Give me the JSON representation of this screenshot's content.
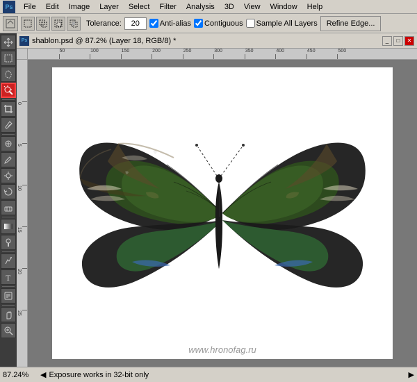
{
  "menubar": {
    "logo": "Ps",
    "items": [
      "File",
      "Edit",
      "Image",
      "Layer",
      "Select",
      "Filter",
      "Analysis",
      "3D",
      "View",
      "Window",
      "Help"
    ]
  },
  "optionsbar": {
    "tolerance_label": "Tolerance:",
    "tolerance_value": "20",
    "anti_alias_label": "Anti-alias",
    "contiguous_label": "Contiguous",
    "sample_all_layers_label": "Sample All Layers",
    "refine_edge_label": "Refine Edge...",
    "anti_alias_checked": true,
    "contiguous_checked": true,
    "sample_all_layers_checked": false
  },
  "document": {
    "title": "shablon.psd @ 87.2% (Layer 18, RGB/8) *"
  },
  "statusbar": {
    "zoom": "87.24%",
    "info": "Exposure works in 32-bit only"
  },
  "watermark": "www.hronofag.ru",
  "ruler": {
    "h_labels": [
      "50",
      "100",
      "150",
      "200",
      "250",
      "300",
      "350",
      "400",
      "450",
      "500"
    ],
    "v_labels": [
      "0",
      "5",
      "10",
      "15",
      "20",
      "25"
    ]
  },
  "toolbar": {
    "tools": [
      {
        "id": "move",
        "icon": "✦",
        "active": false
      },
      {
        "id": "rect-marquee",
        "icon": "⬚",
        "active": false
      },
      {
        "id": "lasso",
        "icon": "𝓛",
        "active": false
      },
      {
        "id": "magic-wand",
        "icon": "✲",
        "active": true,
        "highlighted": true
      },
      {
        "id": "crop",
        "icon": "⊹",
        "active": false
      },
      {
        "id": "eyedropper",
        "icon": "⊿",
        "active": false
      },
      {
        "id": "healing",
        "icon": "✚",
        "active": false
      },
      {
        "id": "brush",
        "icon": "✏",
        "active": false
      },
      {
        "id": "clone",
        "icon": "◉",
        "active": false
      },
      {
        "id": "history",
        "icon": "↩",
        "active": false
      },
      {
        "id": "eraser",
        "icon": "◻",
        "active": false
      },
      {
        "id": "gradient",
        "icon": "▦",
        "active": false
      },
      {
        "id": "dodge",
        "icon": "○",
        "active": false
      },
      {
        "id": "pen",
        "icon": "✒",
        "active": false
      },
      {
        "id": "type",
        "icon": "T",
        "active": false
      },
      {
        "id": "path-select",
        "icon": "↖",
        "active": false
      },
      {
        "id": "shape",
        "icon": "▭",
        "active": false
      },
      {
        "id": "notes",
        "icon": "✎",
        "active": false
      },
      {
        "id": "hand",
        "icon": "✋",
        "active": false
      },
      {
        "id": "zoom",
        "icon": "⊕",
        "active": false
      }
    ]
  }
}
